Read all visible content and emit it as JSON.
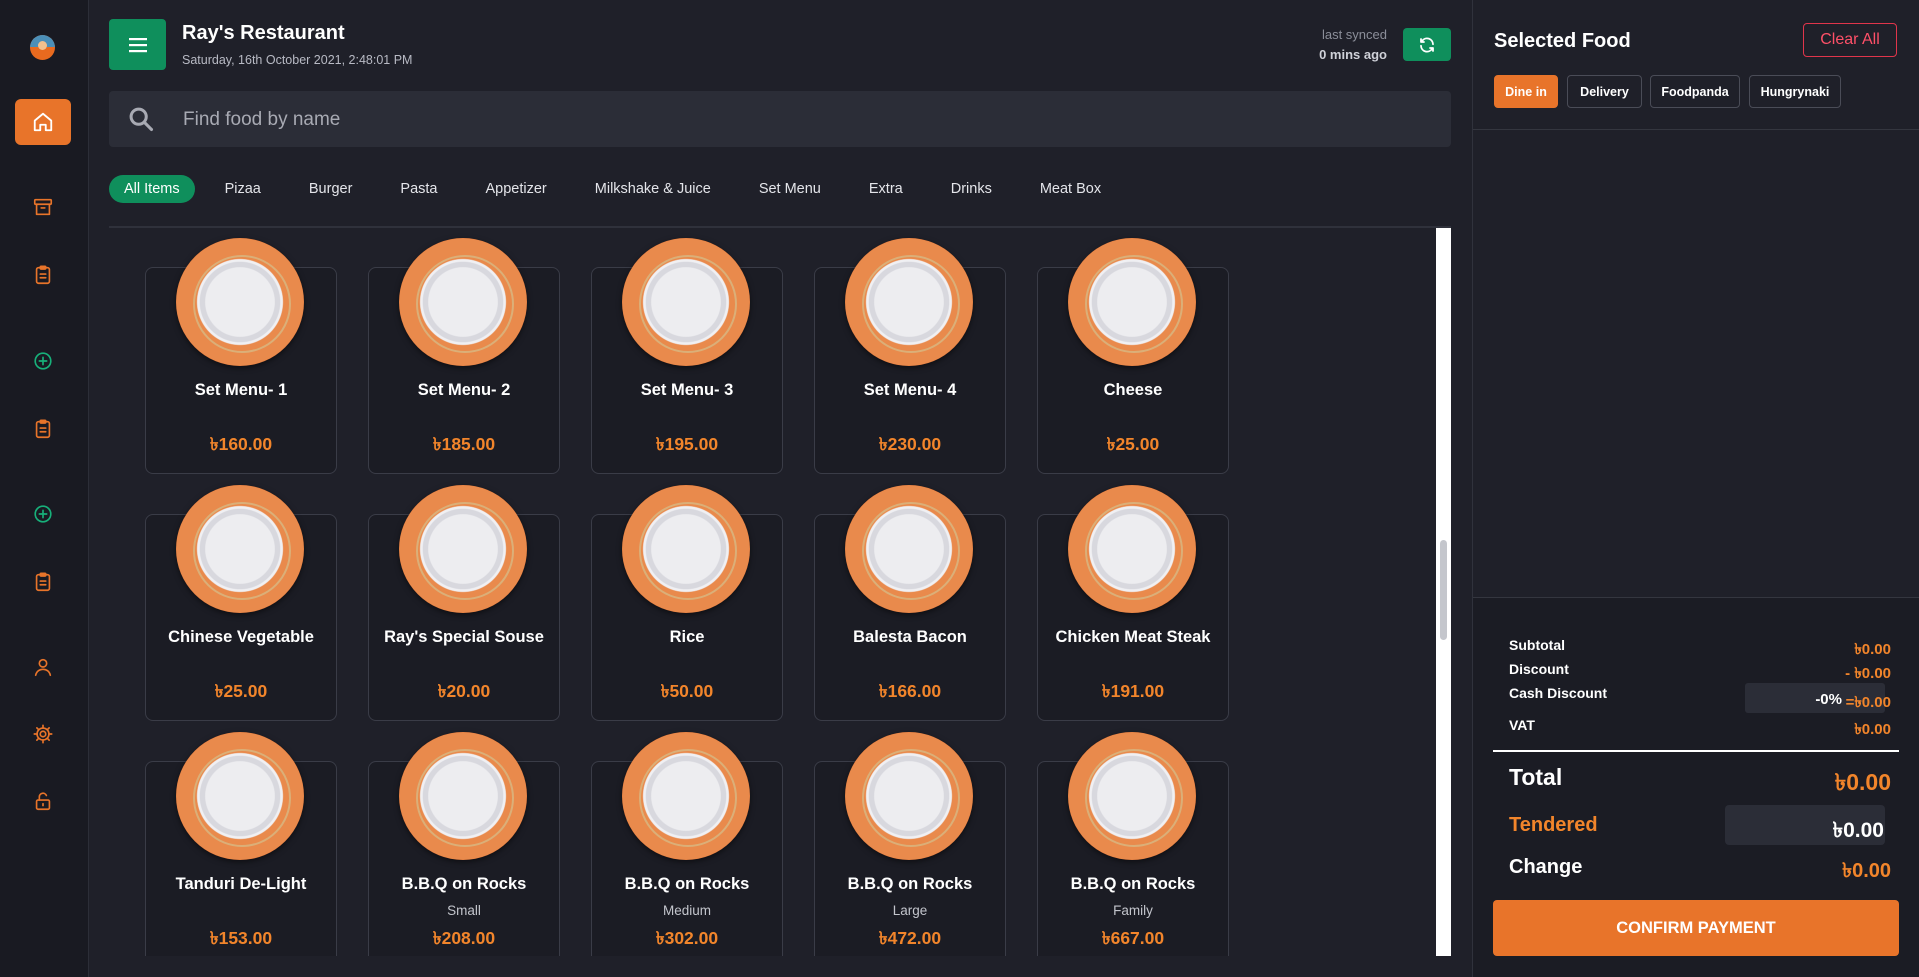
{
  "header": {
    "title": "Ray's Restaurant",
    "datetime": "Saturday, 16th October 2021, 2:48:01 PM",
    "sync_label": "last synced",
    "sync_ago": "0 mins ago"
  },
  "search": {
    "placeholder": "Find food by name"
  },
  "categories": [
    "All Items",
    "Pizaa",
    "Burger",
    "Pasta",
    "Appetizer",
    "Milkshake & Juice",
    "Set Menu",
    "Extra",
    "Drinks",
    "Meat Box"
  ],
  "active_category": "All Items",
  "items": [
    {
      "name": "Set Menu- 1",
      "sub": "",
      "price": "৳160.00"
    },
    {
      "name": "Set Menu- 2",
      "sub": "",
      "price": "৳185.00"
    },
    {
      "name": "Set Menu- 3",
      "sub": "",
      "price": "৳195.00"
    },
    {
      "name": "Set Menu- 4",
      "sub": "",
      "price": "৳230.00"
    },
    {
      "name": "Cheese",
      "sub": "",
      "price": "৳25.00"
    },
    {
      "name": "Chinese Vegetable",
      "sub": "",
      "price": "৳25.00"
    },
    {
      "name": "Ray's Special Souse",
      "sub": "",
      "price": "৳20.00"
    },
    {
      "name": "Rice",
      "sub": "",
      "price": "৳50.00"
    },
    {
      "name": "Balesta Bacon",
      "sub": "",
      "price": "৳166.00"
    },
    {
      "name": "Chicken Meat Steak",
      "sub": "",
      "price": "৳191.00"
    },
    {
      "name": "Tanduri De-Light",
      "sub": "",
      "price": "৳153.00"
    },
    {
      "name": "B.B.Q on Rocks",
      "sub": "Small",
      "price": "৳208.00"
    },
    {
      "name": "B.B.Q on Rocks",
      "sub": "Medium",
      "price": "৳302.00"
    },
    {
      "name": "B.B.Q on Rocks",
      "sub": "Large",
      "price": "৳472.00"
    },
    {
      "name": "B.B.Q on Rocks",
      "sub": "Family",
      "price": "৳667.00"
    }
  ],
  "panel": {
    "title": "Selected Food",
    "clear_label": "Clear All",
    "order_types": [
      "Dine in",
      "Delivery",
      "Foodpanda",
      "Hungrynaki"
    ],
    "active_order_type": "Dine in",
    "summary": {
      "subtotal_label": "Subtotal",
      "subtotal_value": "৳0.00",
      "discount_label": "Discount",
      "discount_value": "- ৳0.00",
      "cash_discount_label": "Cash Discount",
      "cash_discount_pct": "-0%",
      "cash_discount_value": "=৳0.00",
      "vat_label": "VAT",
      "vat_value": "৳0.00",
      "total_label": "Total",
      "total_value": "৳0.00",
      "tendered_label": "Tendered",
      "tendered_value": "৳0.00",
      "change_label": "Change",
      "change_value": "৳0.00"
    },
    "confirm_label": "CONFIRM PAYMENT"
  },
  "nav_icons": [
    "home-icon",
    "archive-icon",
    "clipboard-icon",
    "plus-circle-icon",
    "clipboard-icon",
    "plus-circle-icon",
    "clipboard-icon",
    "user-icon",
    "gear-icon",
    "unlock-icon"
  ],
  "colors": {
    "accent": "#e8742a",
    "green": "#0f8f5c",
    "price": "#f2852b",
    "danger": "#e0354b"
  }
}
